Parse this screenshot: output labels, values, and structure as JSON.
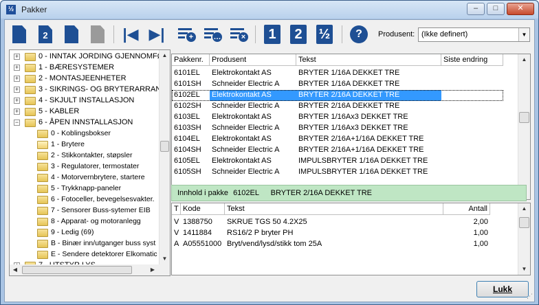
{
  "window": {
    "title": "Pakker",
    "app_icon_glyph": "½"
  },
  "toolbar": {
    "buttons": [
      {
        "name": "new-doc-icon"
      },
      {
        "name": "copy-number-icon"
      },
      {
        "name": "copy-docs-icon"
      },
      {
        "name": "paste-icon"
      },
      {
        "name": "first-record-icon"
      },
      {
        "name": "last-record-icon"
      },
      {
        "name": "add-line-icon"
      },
      {
        "name": "more-lines-icon"
      },
      {
        "name": "delete-line-icon"
      },
      {
        "name": "view-1-icon"
      },
      {
        "name": "view-2-icon"
      },
      {
        "name": "view-half-icon"
      },
      {
        "name": "help-icon"
      }
    ],
    "view_labels": [
      "1",
      "2",
      "½"
    ],
    "doc_label": "2",
    "help_label": "?",
    "produsent_label": "Produsent:",
    "produsent_value": "(Ikke definert)"
  },
  "tree": {
    "items": [
      {
        "label": "0 - INNTAK JORDING GJENNOMFØ",
        "level": 0,
        "expander": "+"
      },
      {
        "label": "1 - BÆRESYSTEMER",
        "level": 0,
        "expander": "+"
      },
      {
        "label": "2 - MONTASJEENHETER",
        "level": 0,
        "expander": "+"
      },
      {
        "label": "3 - SIKRINGS- OG BRYTERARRAN",
        "level": 0,
        "expander": "+"
      },
      {
        "label": "4 - SKJULT INSTALLASJON",
        "level": 0,
        "expander": "+"
      },
      {
        "label": "5 - KABLER",
        "level": 0,
        "expander": "+"
      },
      {
        "label": "6 - ÅPEN INNSTALLASJON",
        "level": 0,
        "expander": "−"
      },
      {
        "label": "0 - Koblingsbokser",
        "level": 1
      },
      {
        "label": "1 - Brytere",
        "level": 1,
        "open": true
      },
      {
        "label": "2 - Stikkontakter, støpsler",
        "level": 1
      },
      {
        "label": "3 - Regulatorer, termostater",
        "level": 1
      },
      {
        "label": "4 - Motorvernbrytere, startere",
        "level": 1
      },
      {
        "label": "5 - Trykknapp-paneler",
        "level": 1
      },
      {
        "label": "6 - Fotoceller, bevegelsesvakter.",
        "level": 1
      },
      {
        "label": "7 - Sensorer Buss-sytemer EIB",
        "level": 1
      },
      {
        "label": "8 - Apparat- og motoranlegg",
        "level": 1
      },
      {
        "label": "9 - Ledig (69)",
        "level": 1
      },
      {
        "label": "B - Binær inn/utganger buss syst",
        "level": 1
      },
      {
        "label": "E - Sendere detektorer Elkomatic",
        "level": 1
      },
      {
        "label": "7 - UTSTYR LYS",
        "level": 0,
        "expander": "+"
      }
    ]
  },
  "packages": {
    "columns": [
      "Pakkenr.",
      "Produsent",
      "Tekst",
      "Siste endring"
    ],
    "rows": [
      [
        "6101EL",
        "Elektrokontakt AS",
        "BRYTER 1/16A DEKKET TRE",
        ""
      ],
      [
        "6101SH",
        "Schneider Electric A",
        "BRYTER 1/16A DEKKET TRE",
        ""
      ],
      [
        "6102EL",
        "Elektrokontakt AS",
        "BRYTER 2/16A DEKKET TRE",
        ""
      ],
      [
        "6102SH",
        "Schneider Electric A",
        "BRYTER 2/16A DEKKET TRE",
        ""
      ],
      [
        "6103EL",
        "Elektrokontakt AS",
        "BRYTER 1/16Ax3 DEKKET TRE",
        ""
      ],
      [
        "6103SH",
        "Schneider Electric A",
        "BRYTER 1/16Ax3 DEKKET TRE",
        ""
      ],
      [
        "6104EL",
        "Elektrokontakt AS",
        "BRYTER 2/16A+1/16A DEKKET TRE",
        ""
      ],
      [
        "6104SH",
        "Schneider Electric A",
        "BRYTER 2/16A+1/16A DEKKET TRE",
        ""
      ],
      [
        "6105EL",
        "Elektrokontakt AS",
        "IMPULSBRYTER 1/16A DEKKET TRE",
        ""
      ],
      [
        "6105SH",
        "Schneider Electric A",
        "IMPULSBRYTER 1/16A DEKKET TRE",
        ""
      ]
    ],
    "selected_index": 2
  },
  "banner": {
    "label": "Innhold i pakke",
    "package": "6102EL",
    "text": "BRYTER 2/16A DEKKET TRE"
  },
  "contents": {
    "columns": [
      "T",
      "Kode",
      "Tekst",
      "Antall"
    ],
    "rows": [
      [
        "V",
        "1388750",
        "SKRUE TGS 50 4.2X25",
        "2,00"
      ],
      [
        "V",
        "1411884",
        "RS16/2 P bryter  PH",
        "1,00"
      ],
      [
        "A",
        "A05551000",
        "Bryt/vend/lysd/stikk tom 25A",
        "1,00"
      ]
    ]
  },
  "footer": {
    "close_label": "Lukk"
  },
  "colors": {
    "selection": "#3399ff",
    "banner": "#bfe6c4",
    "icon_blue": "#1e4f94"
  }
}
